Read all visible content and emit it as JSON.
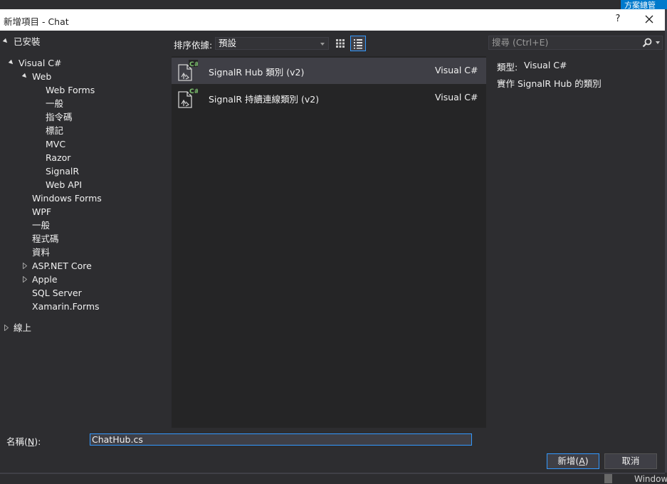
{
  "background_window": {
    "top_right_text": "方案總管",
    "bottom_right_text": "Window"
  },
  "dialog": {
    "title": "新增項目 - Chat",
    "help_label": "?",
    "close_icon": "close-icon"
  },
  "tree": {
    "installed_label": "已安裝",
    "items": [
      {
        "label": "Visual C#"
      },
      {
        "label": "Web"
      },
      {
        "label": "Web Forms"
      },
      {
        "label": "一般"
      },
      {
        "label": "指令碼"
      },
      {
        "label": "標記"
      },
      {
        "label": "MVC"
      },
      {
        "label": "Razor"
      },
      {
        "label": "SignalR"
      },
      {
        "label": "Web API"
      },
      {
        "label": "Windows Forms"
      },
      {
        "label": "WPF"
      },
      {
        "label": "一般"
      },
      {
        "label": "程式碼"
      },
      {
        "label": "資料"
      },
      {
        "label": "ASP.NET Core"
      },
      {
        "label": "Apple"
      },
      {
        "label": "SQL Server"
      },
      {
        "label": "Xamarin.Forms"
      }
    ],
    "online_label": "線上"
  },
  "toolbar": {
    "sort_label": "排序依據:",
    "sort_value": "預設",
    "grid_view_icon": "grid-view-icon",
    "list_view_icon": "list-view-icon"
  },
  "templates": [
    {
      "name": "SignalR Hub 類別 (v2)",
      "language": "Visual C#",
      "icon_badge": "C#",
      "selected": true
    },
    {
      "name": "SignalR 持續連線類別 (v2)",
      "language": "Visual C#",
      "icon_badge": "C#",
      "selected": false
    }
  ],
  "search": {
    "placeholder": "搜尋 (Ctrl+E)",
    "icon": "search-icon"
  },
  "details": {
    "type_label": "類型:",
    "type_value": "Visual C#",
    "description": "實作 SignalR Hub 的類別"
  },
  "footer": {
    "name_label": "名稱",
    "name_accel": "N",
    "name_value": "ChatHub.cs",
    "add_label": "新增",
    "add_accel": "A",
    "cancel_label": "取消"
  },
  "colors": {
    "dialog_bg": "#2d2d30",
    "list_bg": "#252526",
    "selected_row": "#3f3f46",
    "accent": "#3399ff",
    "text": "#f1f1f1"
  }
}
